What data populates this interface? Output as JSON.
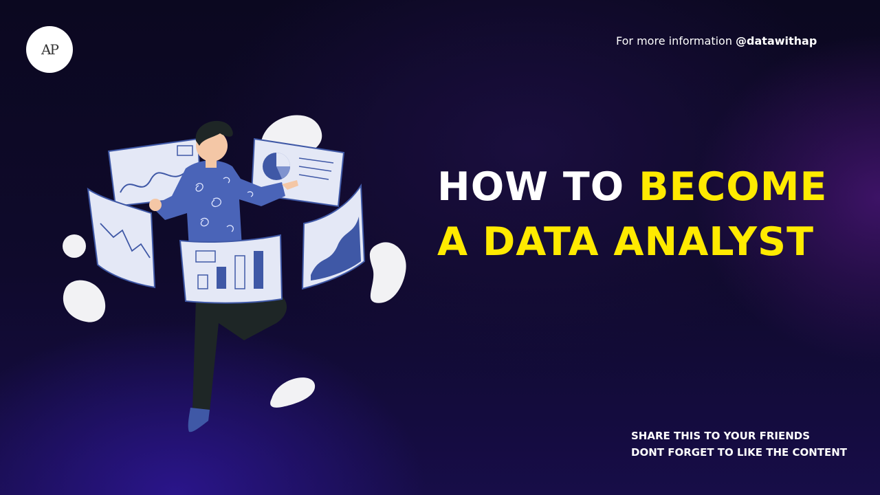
{
  "logo": {
    "text": "AP"
  },
  "info": {
    "prefix": "For more information ",
    "handle": "@datawithap"
  },
  "headline": {
    "line1_white": "HOW TO ",
    "line1_yellow": "BECOME",
    "line2_yellow": "A DATA ANALYST"
  },
  "footer": {
    "line1": "SHARE THIS TO YOUR FRIENDS",
    "line2": "DONT FORGET TO LIKE THE CONTENT"
  },
  "colors": {
    "accent_yellow": "#ffea00",
    "text_white": "#ffffff",
    "panel": "#e4e8f6",
    "chart_blue": "#3f58a6",
    "shirt": "#4a64b8",
    "pants": "#1e2626"
  },
  "icons": [
    "analyst-illustration-icon",
    "pie-chart-icon",
    "bar-chart-icon",
    "line-chart-icon"
  ]
}
